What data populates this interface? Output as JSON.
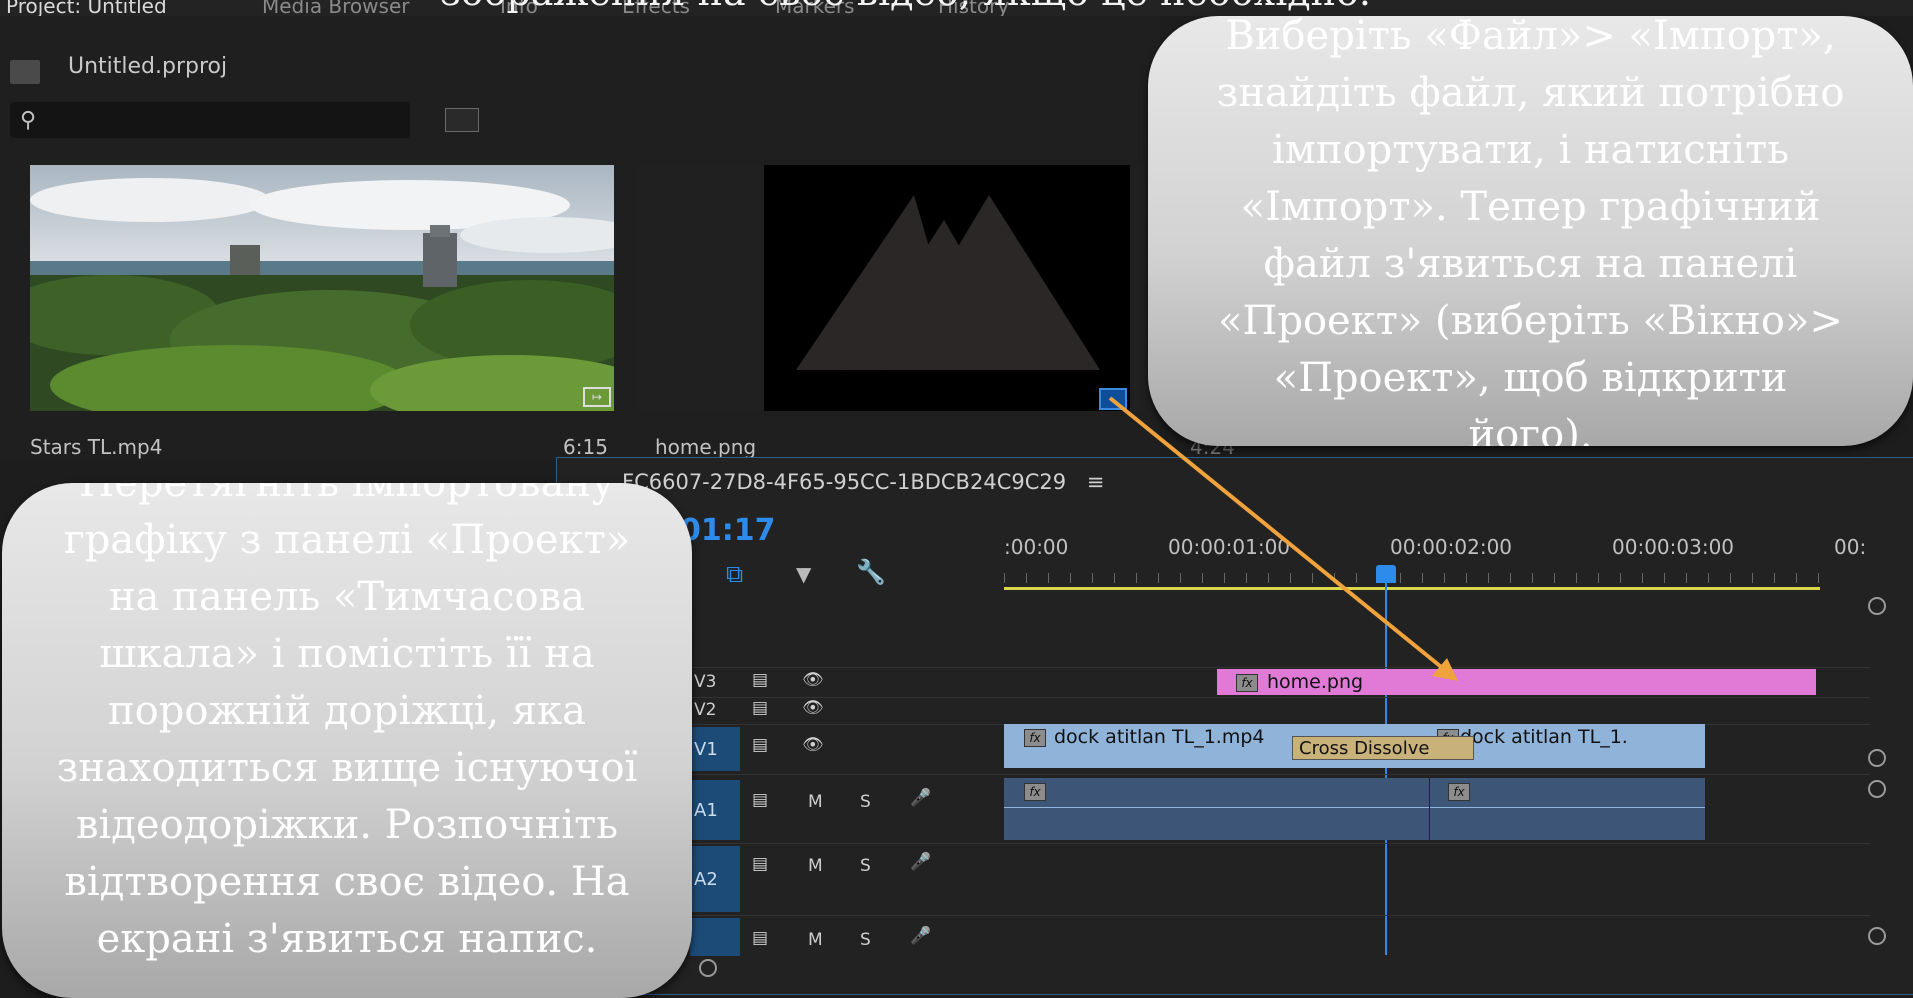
{
  "tabs": [
    "Project: Untitled",
    "Media Browser",
    "Info",
    "Effects",
    "Markers",
    "History"
  ],
  "top_instruction": "зображення на своє відео, якщо це необхідно.",
  "project": {
    "file_name": "Untitled.prproj",
    "search_placeholder": "",
    "clips": [
      {
        "name": "Stars TL.mp4",
        "duration": "6:15"
      },
      {
        "name": "home.png",
        "duration": "4:24"
      }
    ]
  },
  "timeline": {
    "sequence_name": "FC6607-27D8-4F65-95CC-1BDCB24C9C29",
    "timecode": "01:17",
    "ruler_labels": [
      ":00:00",
      "00:00:01:00",
      "00:00:02:00",
      "00:00:03:00",
      "00:"
    ],
    "tracks": {
      "v3": "V3",
      "v2": "V2",
      "v1": "V1",
      "a1": "A1",
      "a2": "A2",
      "mute": "M",
      "solo": "S"
    },
    "clips": {
      "graphic": "home.png",
      "video1": "dock atitlan TL_1.mp4",
      "transition": "Cross Dissolve",
      "video2": "dock atitlan TL_1.",
      "fx": "fx"
    }
  },
  "callouts": {
    "right": "Виберіть «Файл»> «Імпорт», знайдіть файл, який потрібно імпортувати, і натисніть «Імпорт». Тепер графічний файл з'явиться на панелі «Проект» (виберіть «Вікно»> «Проект», щоб відкрити його).",
    "left": "Перетягніть імпортовану графіку з панелі «Проект» на панель «Тимчасова шкала» і помістіть її на порожній доріжці, яка знаходиться вище існуючої відеодоріжки. Розпочніть відтворення своє відео. На екрані з'явиться напис."
  },
  "colors": {
    "accent": "#2d8ceb",
    "graphic_clip": "#e07ad6",
    "video_clip": "#8fb3d9",
    "audio_clip": "#3d5577",
    "work_area": "#d8d84a",
    "arrow": "#f0a23c"
  }
}
